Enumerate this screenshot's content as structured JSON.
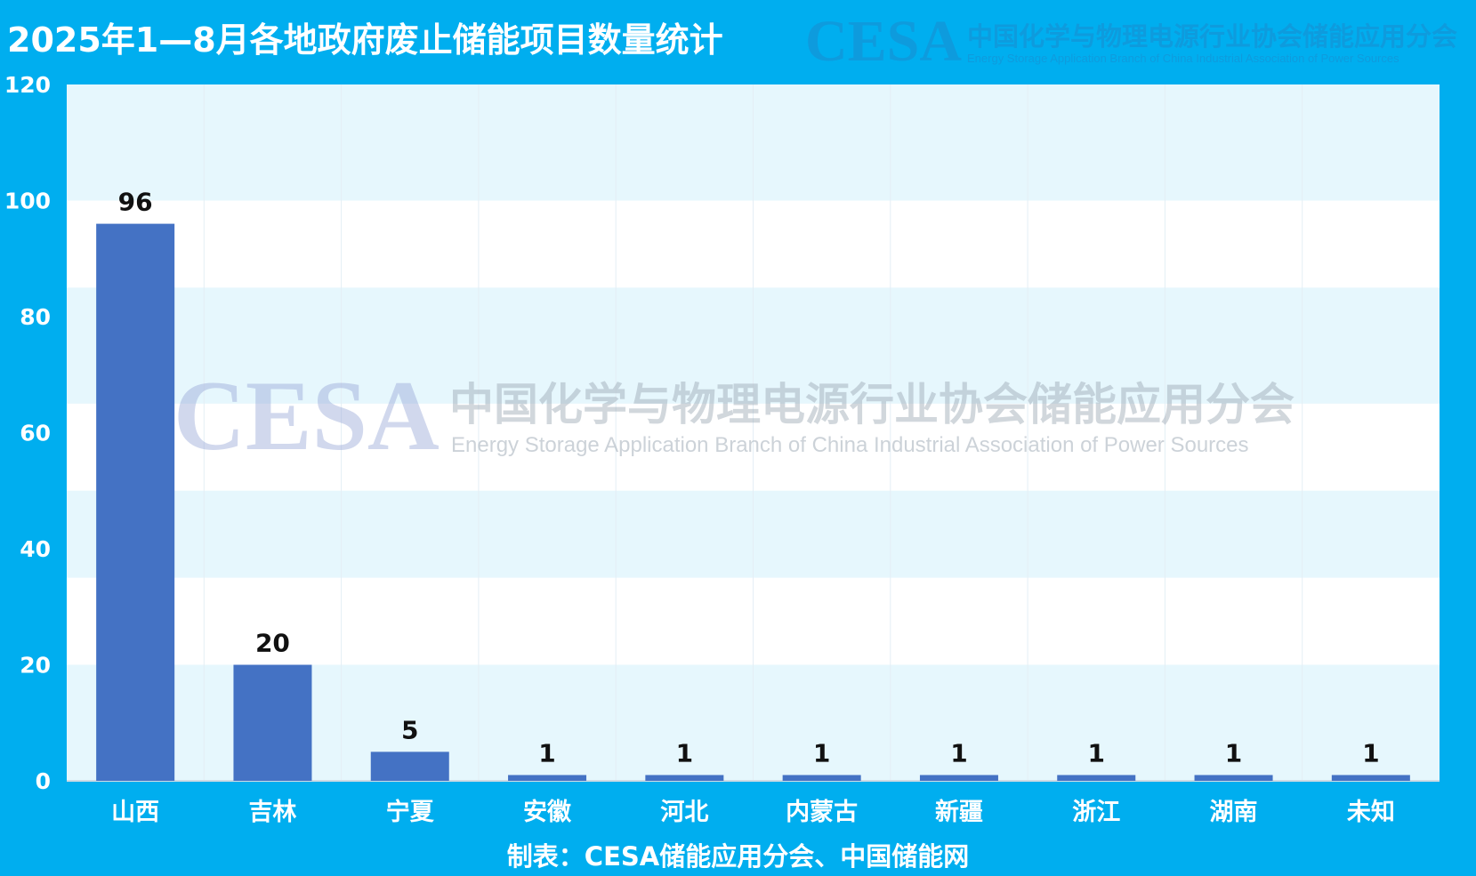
{
  "title": "2025年1—8月各地政府废止储能项目数量统计",
  "watermark": {
    "mark": "CESA",
    "cn": "中国化学与物理电源行业协会储能应用分会",
    "en": "Energy Storage Application Branch of China Industrial Association of Power Sources"
  },
  "footer": "制表：CESA储能应用分会、中国储能网",
  "colors": {
    "background": "#00aeef",
    "plot_band_light": "#e6f7fd",
    "plot_band_white": "#ffffff",
    "bar": "#4472c4",
    "watermark_blue": "#9aa9d8",
    "watermark_pink": "#f4a6c2"
  },
  "chart_data": {
    "type": "bar",
    "title": "2025年1—8月各地政府废止储能项目数量统计",
    "categories": [
      "山西",
      "吉林",
      "宁夏",
      "安徽",
      "河北",
      "内蒙古",
      "新疆",
      "浙江",
      "湖南",
      "未知"
    ],
    "values": [
      96,
      20,
      5,
      1,
      1,
      1,
      1,
      1,
      1,
      1
    ],
    "data_labels": [
      "96",
      "20",
      "5",
      "1",
      "1",
      "1",
      "1",
      "1",
      "1",
      "1"
    ],
    "ylim": [
      0,
      120
    ],
    "yticks": [
      0,
      20,
      40,
      60,
      80,
      100,
      120
    ],
    "grid": true,
    "legend": "none"
  }
}
